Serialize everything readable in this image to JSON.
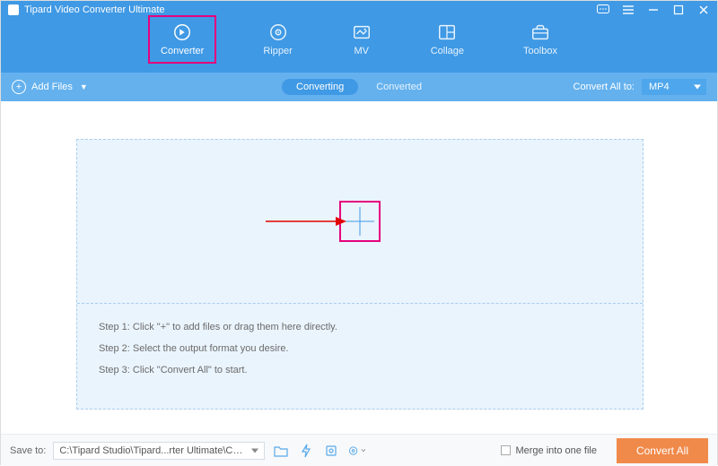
{
  "app": {
    "title": "Tipard Video Converter Ultimate"
  },
  "nav": {
    "tabs": [
      {
        "label": "Converter"
      },
      {
        "label": "Ripper"
      },
      {
        "label": "MV"
      },
      {
        "label": "Collage"
      },
      {
        "label": "Toolbox"
      }
    ]
  },
  "toolbar": {
    "add_files": "Add Files",
    "converting": "Converting",
    "converted": "Converted",
    "convert_all_to": "Convert All to:",
    "format": "MP4"
  },
  "dropzone": {
    "step1": "Step 1: Click \"+\" to add files or drag them here directly.",
    "step2": "Step 2: Select the output format you desire.",
    "step3": "Step 3: Click \"Convert All\" to start."
  },
  "footer": {
    "save_to": "Save to:",
    "path": "C:\\Tipard Studio\\Tipard...rter Ultimate\\Converted",
    "merge": "Merge into one file",
    "convert_all": "Convert All"
  }
}
